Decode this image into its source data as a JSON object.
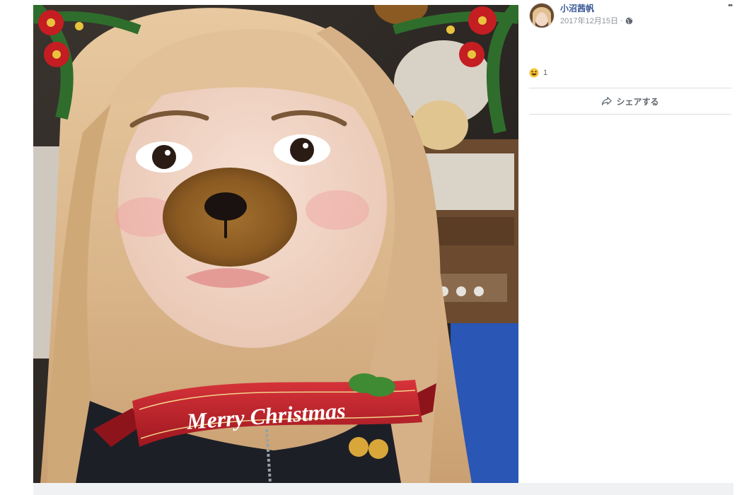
{
  "post": {
    "author": "小沼茜帆",
    "date": "2017年12月15日",
    "separator": "·",
    "privacy_icon": "globe-icon",
    "more_icon": "more-options-icon",
    "reaction_icon": "haha-icon",
    "reaction_count": "1",
    "share_label": "シェアする",
    "share_icon": "share-arrow-icon"
  },
  "photo": {
    "banner_text": "Merry Christmas"
  },
  "colors": {
    "link": "#385898",
    "meta": "#90949c",
    "action": "#606770",
    "divider": "#dadde1",
    "banner_red": "#c0202a"
  }
}
